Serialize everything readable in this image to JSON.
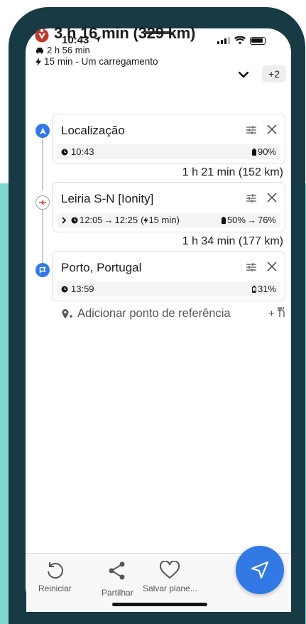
{
  "status": {
    "time": "10:43"
  },
  "header": {
    "title": "3 h 16 min (329 km)",
    "drive_time": "2 h 56 min",
    "charge_summary": "15 min - Um carregamento",
    "extra_routes": "+2"
  },
  "stops": [
    {
      "name": "Localização",
      "time": "10:43",
      "battery": "90%"
    },
    {
      "name": "Leiria S-N [Ionity]",
      "arrive": "12:05",
      "depart": "12:25",
      "charge": "15 min",
      "battery_from": "50%",
      "battery_to": "76%"
    },
    {
      "name": "Porto, Portugal",
      "time": "13:59",
      "battery": "31%"
    }
  ],
  "legs": [
    "1 h 21 min (152 km)",
    "1 h 34 min (177 km)"
  ],
  "add_waypoint": "Adicionar ponto de referência",
  "extras": "+",
  "bottom": {
    "restart": "Reiniciar",
    "share": "Partilhar",
    "save": "Salvar plane..."
  },
  "colors": {
    "accent": "#3279e6",
    "frame": "#173a44",
    "teal": "#7fd6d0",
    "logo_red": "#c0392b"
  }
}
